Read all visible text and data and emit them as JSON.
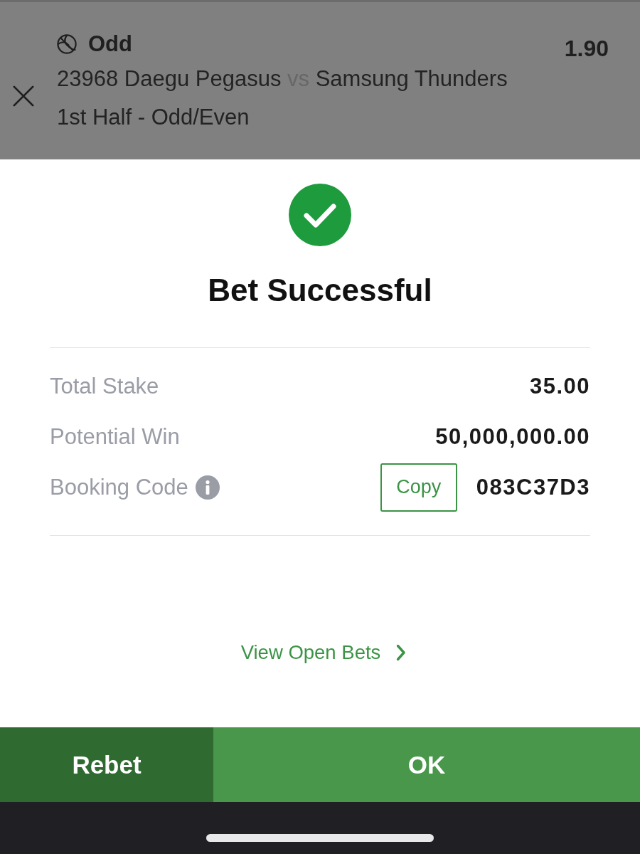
{
  "bet": {
    "selection": "Odd",
    "odds": "1.90",
    "match": {
      "home": "23968 Daegu Pegasus",
      "separator": "vs",
      "away": "Samsung Thunders"
    },
    "market": "1st Half - Odd/Even"
  },
  "result": {
    "title": "Bet Successful"
  },
  "summary": [
    {
      "label": "Total Stake",
      "value": "35.00",
      "info": false
    },
    {
      "label": "Potential Win",
      "value": "50,000,000.00",
      "info": false
    },
    {
      "label": "Booking Code",
      "value": "083C37D3",
      "info": true,
      "copy_label": "Copy"
    }
  ],
  "link": {
    "label": "View Open Bets"
  },
  "actions": [
    {
      "label": "Rebet",
      "kind": "secondary"
    },
    {
      "label": "OK",
      "kind": "primary"
    }
  ]
}
